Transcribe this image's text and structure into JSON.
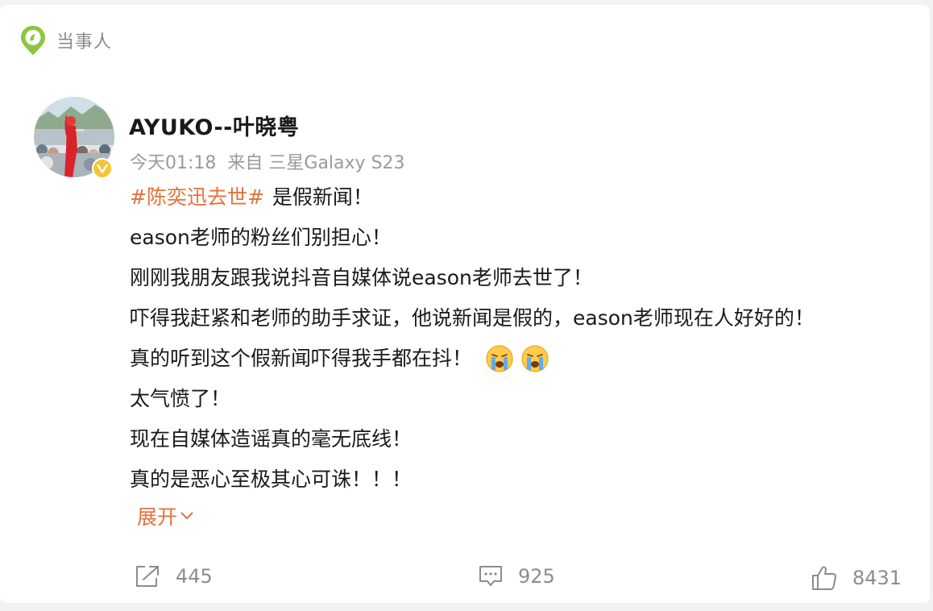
{
  "section": {
    "icon": "location-pin-icon",
    "label": "当事人"
  },
  "post": {
    "author": {
      "name": "AYUKO--叶晓粤",
      "avatar": "avatar-photo",
      "badge": "verified-badge-icon"
    },
    "time": "今天01:18",
    "source": "来自 三星Galaxy S23",
    "hashtag": "#陈奕迅去世#",
    "lines": [
      "是假新闻！",
      "eason老师的粉丝们别担心！",
      "刚刚我朋友跟我说抖音自媒体说eason老师去世了！",
      "吓得我赶紧和老师的助手求证，他说新闻是假的，eason老师现在人好好的！",
      "真的听到这个假新闻吓得我手都在抖！",
      "太气愤了！",
      "现在自媒体造谣真的毫无底线！",
      "真的是恶心至极其心可诛！！！"
    ],
    "emojis": [
      "crying-face-icon",
      "crying-face-icon"
    ],
    "expand_label": "展开"
  },
  "actions": {
    "share_count": "445",
    "comment_count": "925",
    "like_count": "8431"
  },
  "colors": {
    "accent": "#e4713b",
    "pin": "#8cc63f",
    "badge": "#f4c535",
    "text": "#1a1a1a",
    "muted": "#9a9a9a"
  }
}
